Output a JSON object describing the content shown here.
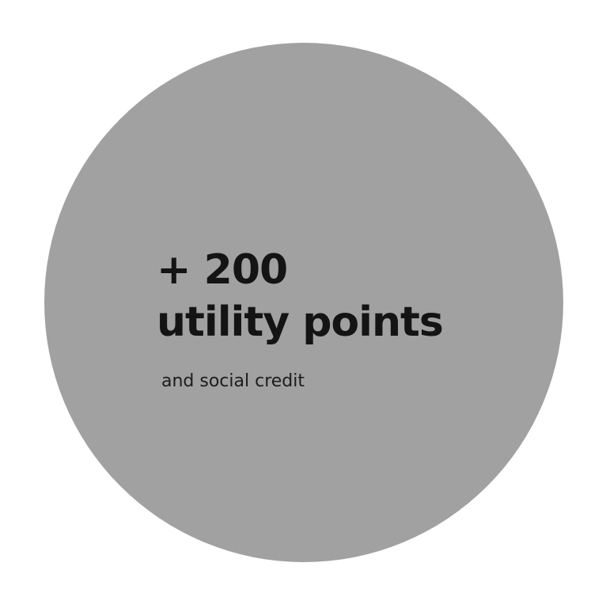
{
  "badge": {
    "headline_line1": "+ 200",
    "headline_line2": "utility points",
    "subtext": "and social credit",
    "circle_color": "#a1a1a1",
    "text_color": "#141414",
    "background_color": "#ffffff"
  }
}
